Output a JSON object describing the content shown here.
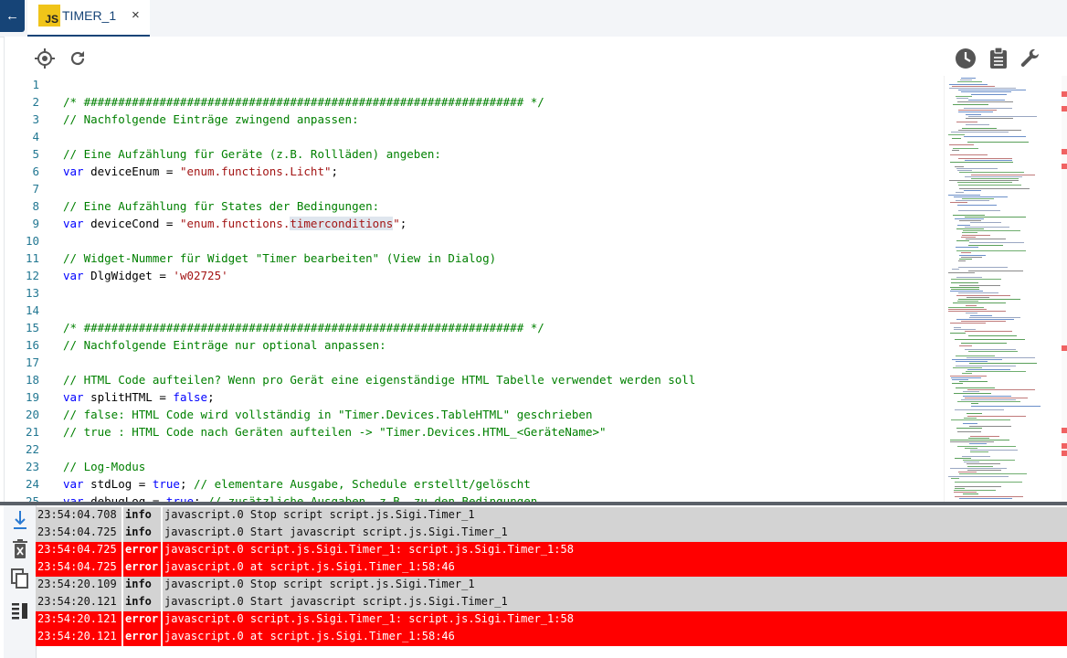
{
  "tab": {
    "icon": "javascript-icon",
    "badge_text": "JS",
    "label": "TIMER_1",
    "close": "×"
  },
  "toolbar": {
    "left_icons": [
      "crosshair-icon",
      "refresh-icon"
    ],
    "right_icons": [
      "history-icon",
      "clipboard-icon",
      "wrench-icon"
    ]
  },
  "editor": {
    "lines": [
      {
        "n": "1",
        "tokens": []
      },
      {
        "n": "2",
        "tokens": [
          {
            "t": "/* ################################################################ */",
            "k": "cm"
          }
        ]
      },
      {
        "n": "3",
        "tokens": [
          {
            "t": "// Nachfolgende Einträge zwingend anpassen:",
            "k": "cm"
          }
        ]
      },
      {
        "n": "4",
        "tokens": []
      },
      {
        "n": "5",
        "tokens": [
          {
            "t": "// Eine Aufzählung für Geräte (z.B. Rollläden) angeben:",
            "k": "cm"
          }
        ]
      },
      {
        "n": "6",
        "tokens": [
          {
            "t": "var",
            "k": "kw"
          },
          {
            "t": " deviceEnum = ",
            "k": ""
          },
          {
            "t": "\"enum.functions.Licht\"",
            "k": "st"
          },
          {
            "t": ";",
            "k": ""
          }
        ]
      },
      {
        "n": "7",
        "tokens": []
      },
      {
        "n": "8",
        "tokens": [
          {
            "t": "// Eine Aufzählung für States der Bedingungen:",
            "k": "cm"
          }
        ]
      },
      {
        "n": "9",
        "tokens": [
          {
            "t": "var",
            "k": "kw"
          },
          {
            "t": " deviceCond = ",
            "k": ""
          },
          {
            "t": "\"enum.functions.",
            "k": "st"
          },
          {
            "t": "timerconditions",
            "k": "st hl"
          },
          {
            "t": "\"",
            "k": "st"
          },
          {
            "t": ";",
            "k": ""
          }
        ]
      },
      {
        "n": "10",
        "tokens": []
      },
      {
        "n": "11",
        "tokens": [
          {
            "t": "// Widget-Nummer für Widget \"Timer bearbeiten\" (View in Dialog)",
            "k": "cm"
          }
        ]
      },
      {
        "n": "12",
        "tokens": [
          {
            "t": "var",
            "k": "kw"
          },
          {
            "t": " DlgWidget = ",
            "k": ""
          },
          {
            "t": "'w02725'",
            "k": "st"
          }
        ]
      },
      {
        "n": "13",
        "tokens": []
      },
      {
        "n": "14",
        "tokens": []
      },
      {
        "n": "15",
        "tokens": [
          {
            "t": "/* ################################################################ */",
            "k": "cm"
          }
        ]
      },
      {
        "n": "16",
        "tokens": [
          {
            "t": "// Nachfolgende Einträge nur optional anpassen:",
            "k": "cm"
          }
        ]
      },
      {
        "n": "17",
        "tokens": []
      },
      {
        "n": "18",
        "tokens": [
          {
            "t": "// HTML Code aufteilen? Wenn pro Gerät eine eigenständige HTML Tabelle verwendet werden soll",
            "k": "cm"
          }
        ]
      },
      {
        "n": "19",
        "tokens": [
          {
            "t": "var",
            "k": "kw"
          },
          {
            "t": " splitHTML = ",
            "k": ""
          },
          {
            "t": "false",
            "k": "kw"
          },
          {
            "t": ";",
            "k": ""
          }
        ]
      },
      {
        "n": "20",
        "tokens": [
          {
            "t": "// false: HTML Code wird vollständig in \"Timer.Devices.TableHTML\" geschrieben",
            "k": "cm"
          }
        ]
      },
      {
        "n": "21",
        "tokens": [
          {
            "t": "// true : HTML Code nach Geräten aufteilen -> \"Timer.Devices.HTML_<GeräteName>\"",
            "k": "cm"
          }
        ]
      },
      {
        "n": "22",
        "tokens": []
      },
      {
        "n": "23",
        "tokens": [
          {
            "t": "// Log-Modus",
            "k": "cm"
          }
        ]
      },
      {
        "n": "24",
        "tokens": [
          {
            "t": "var",
            "k": "kw"
          },
          {
            "t": " stdLog = ",
            "k": ""
          },
          {
            "t": "true",
            "k": "kw"
          },
          {
            "t": "; ",
            "k": ""
          },
          {
            "t": "// elementare Ausgabe, Schedule erstellt/gelöscht",
            "k": "cm"
          }
        ]
      },
      {
        "n": "25",
        "tokens": [
          {
            "t": "var",
            "k": "kw"
          },
          {
            "t": " debugLog = ",
            "k": ""
          },
          {
            "t": "true",
            "k": "kw"
          },
          {
            "t": "; ",
            "k": ""
          },
          {
            "t": "// zusätzliche Ausgaben, z.B. zu den Bedingungen",
            "k": "cm"
          }
        ]
      }
    ]
  },
  "log_panel": {
    "side_icons": [
      "scroll-down-icon",
      "delete-icon",
      "copy-icon",
      "filter-icon"
    ],
    "rows": [
      {
        "time": "23:54:04.708",
        "severity": "info",
        "message": "javascript.0 Stop script script.js.Sigi.Timer_1"
      },
      {
        "time": "23:54:04.725",
        "severity": "info",
        "message": "javascript.0 Start javascript script.js.Sigi.Timer_1"
      },
      {
        "time": "23:54:04.725",
        "severity": "error",
        "message": "javascript.0 script.js.Sigi.Timer_1: script.js.Sigi.Timer_1:58"
      },
      {
        "time": "23:54:04.725",
        "severity": "error",
        "message": "javascript.0 at script.js.Sigi.Timer_1:58:46"
      },
      {
        "time": "23:54:20.109",
        "severity": "info",
        "message": "javascript.0 Stop script script.js.Sigi.Timer_1"
      },
      {
        "time": "23:54:20.121",
        "severity": "info",
        "message": "javascript.0 Start javascript script.js.Sigi.Timer_1"
      },
      {
        "time": "23:54:20.121",
        "severity": "error",
        "message": "javascript.0 script.js.Sigi.Timer_1: script.js.Sigi.Timer_1:58"
      },
      {
        "time": "23:54:20.121",
        "severity": "error",
        "message": "javascript.0 at script.js.Sigi.Timer_1:58:46"
      }
    ]
  },
  "colors": {
    "accent": "#164477",
    "error_row": "#ff0000",
    "info_row": "#d3d3d3",
    "comment": "#008000",
    "keyword": "#0000ff",
    "string": "#a31515",
    "line_number": "#237893"
  }
}
